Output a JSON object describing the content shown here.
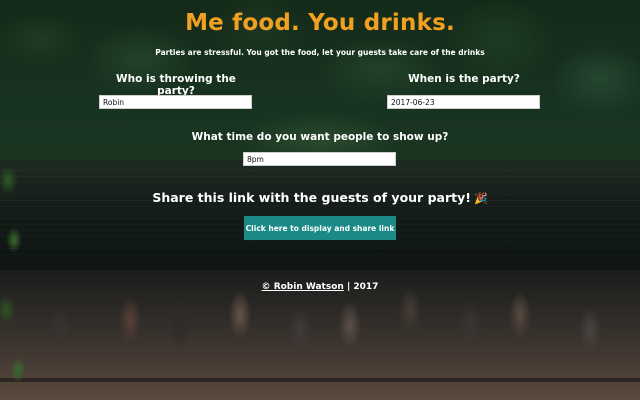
{
  "header": {
    "title": "Me food. You drinks.",
    "subtitle": "Parties are stressful. You got the food, let your guests take care of the drinks"
  },
  "form": {
    "host": {
      "label": "Who is throwing the party?",
      "value": "Robin"
    },
    "date": {
      "label": "When is the party?",
      "value": "2017-06-23"
    },
    "time": {
      "label": "What time do you want people to show up?",
      "value": "8pm"
    }
  },
  "share": {
    "heading": "Share this link with the guests of your party!",
    "icon": "party-popper-icon",
    "icon_glyph": "🎉",
    "button_label": "Click here to display and share link"
  },
  "footer": {
    "copyright_symbol": "©",
    "author": "Robin Watson",
    "separator": "|",
    "year": "2017"
  },
  "colors": {
    "title": "#f2a022",
    "button": "#1a8a86",
    "text": "#ffffff"
  }
}
